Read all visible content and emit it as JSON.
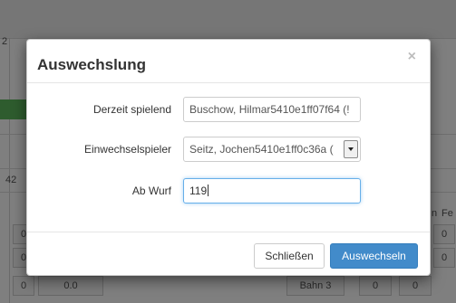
{
  "background": {
    "left_digit": "2",
    "left_number": "42",
    "right_header": "Fe",
    "right_letter": "n",
    "rows": [
      {
        "a": "0",
        "b": "0"
      },
      {
        "a": "0",
        "b": "0"
      },
      {
        "a": "0",
        "b": "0.0",
        "lane": "Bahn 3",
        "c": "0",
        "d": "0"
      }
    ]
  },
  "modal": {
    "title": "Auswechslung",
    "close_symbol": "×",
    "fields": {
      "current_player": {
        "label": "Derzeit spielend",
        "value": "Buschow, Hilmar5410e1ff07f64 (!"
      },
      "sub_player": {
        "label": "Einwechselspieler",
        "value": "Seitz, Jochen5410e1ff0c36a ("
      },
      "from_throw": {
        "label": "Ab Wurf",
        "value": "119"
      }
    },
    "footer": {
      "close_label": "Schließen",
      "submit_label": "Auswechseln"
    }
  },
  "colors": {
    "primary": "#428bca",
    "backdrop": "rgba(0,0,0,0.5)",
    "bg_accent": "#5cb85c"
  }
}
